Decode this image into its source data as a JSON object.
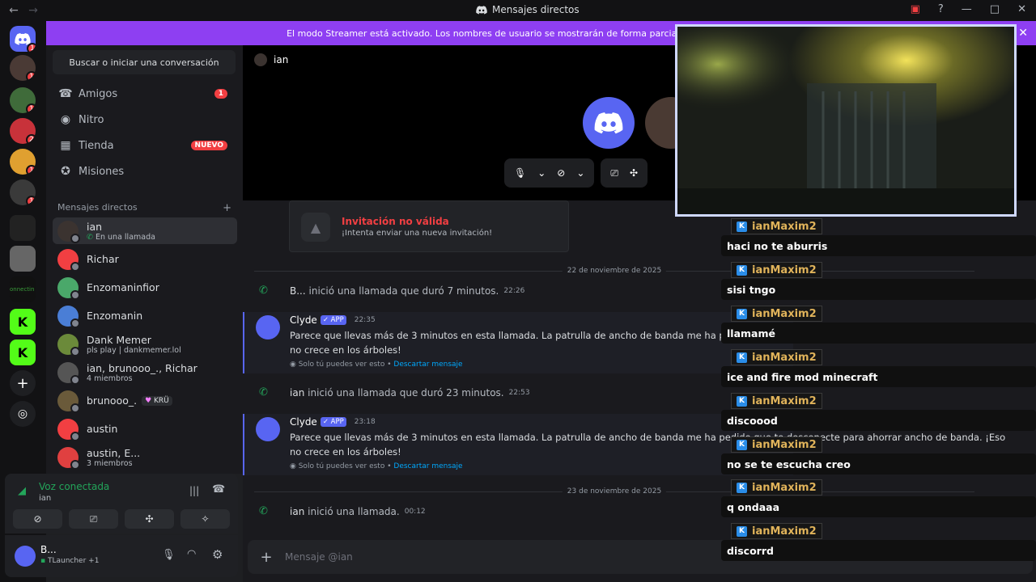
{
  "titlebar": {
    "title": "Mensajes directos"
  },
  "banner": {
    "text": "El modo Streamer está activado. Los nombres de usuario se mostrarán de forma parcial."
  },
  "servers": [
    {
      "name": "discord-home-icon",
      "badge": "1"
    },
    {
      "name": "server-avatar",
      "badge": "1"
    },
    {
      "name": "server-frog",
      "badge": "1"
    },
    {
      "name": "server-red",
      "badge": "2"
    },
    {
      "name": "server-colorful",
      "badge": "1"
    },
    {
      "name": "server-dark",
      "badge": "1"
    }
  ],
  "sidebar": {
    "search_placeholder": "Buscar o iniciar una conversación",
    "nav": [
      {
        "label": "Amigos",
        "badge": "1"
      },
      {
        "label": "Nitro",
        "badge": ""
      },
      {
        "label": "Tienda",
        "badge": "NUEVO"
      },
      {
        "label": "Misiones",
        "badge": ""
      }
    ],
    "dm_header": "Mensajes directos",
    "dms": [
      {
        "name": "ian",
        "sub": "En una llamada",
        "color": "#3b3330"
      },
      {
        "name": "Richar",
        "sub": "",
        "color": "#f23f42"
      },
      {
        "name": "Enzomaninfior",
        "sub": "",
        "color": "#4aa86a"
      },
      {
        "name": "Enzomanin",
        "sub": "",
        "color": "#4a7ed6"
      },
      {
        "name": "Dank Memer",
        "sub": "pls play | dankmemer.lol",
        "color": "#6b8a3a"
      },
      {
        "name": "ian, brunooo_., Richar",
        "sub": "4 miembros",
        "color": "#555555"
      },
      {
        "name": "brunooo_.",
        "sub": "",
        "tag": "KRÜ",
        "color": "#6a5a3a"
      },
      {
        "name": "austin",
        "sub": "",
        "color": "#f23f42"
      },
      {
        "name": "austin, E...",
        "sub": "3 miembros",
        "color": "#e04040"
      }
    ]
  },
  "voice": {
    "status": "Voz conectada",
    "channel": "ian"
  },
  "user": {
    "name": "B...",
    "status": "TLauncher",
    "extra": "+1"
  },
  "call": {
    "title": "ian"
  },
  "messages": {
    "invite_title": "Invitación no válida",
    "invite_sub": "¡Intenta enviar una nueva invitación!",
    "date1": "22 de noviembre de 2025",
    "sys1_user": "B...",
    "sys1_text": "inició una llamada que duró 7 minutos.",
    "sys1_time": "22:26",
    "clyde_name": "Clyde",
    "app_tag": "APP",
    "clyde1_time": "22:35",
    "clyde_text": "Parece que llevas más de 3 minutos en esta llamada. La patrulla de ancho de banda me ha pedido que te desconecte para ahorrar ancho de banda. ¡Eso no crece en los árboles!",
    "clyde_footer": "Solo tú puedes ver esto •",
    "clyde_dismiss": "Descartar mensaje",
    "sys2_user": "ian",
    "sys2_text": "inició una llamada que duró 23 minutos.",
    "sys2_time": "22:53",
    "clyde2_time": "23:18",
    "date2": "23 de noviembre de 2025",
    "sys3_user": "ian",
    "sys3_text": "inició una llamada.",
    "sys3_time": "00:12"
  },
  "composer": {
    "placeholder": "Mensaje @ian"
  },
  "overlay_chat": [
    {
      "user": "ianMaxim2",
      "text": "haci no te aburris"
    },
    {
      "user": "ianMaxim2",
      "text": "sisi tngo"
    },
    {
      "user": "ianMaxim2",
      "text": "llamamé"
    },
    {
      "user": "ianMaxim2",
      "text": "ice and fire mod minecraft"
    },
    {
      "user": "ianMaxim2",
      "text": "discoood"
    },
    {
      "user": "ianMaxim2",
      "text": "no se te escucha creo"
    },
    {
      "user": "ianMaxim2",
      "text": "q ondaaa"
    },
    {
      "user": "ianMaxim2",
      "text": "discorrd"
    }
  ]
}
